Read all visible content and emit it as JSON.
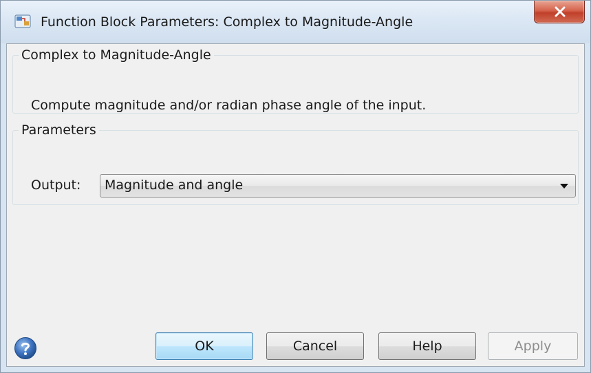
{
  "window": {
    "title": "Function Block Parameters: Complex to Magnitude-Angle",
    "close_glyph": "X"
  },
  "description_group": {
    "legend": "Complex to Magnitude-Angle",
    "text": "Compute magnitude and/or radian phase angle of the input."
  },
  "parameters_group": {
    "legend": "Parameters",
    "output_label": "Output:",
    "output_value": "Magnitude and angle"
  },
  "buttons": {
    "ok": "OK",
    "cancel": "Cancel",
    "help": "Help",
    "apply": "Apply"
  },
  "icons": {
    "app": "simulink-block-icon",
    "help": "help-question-icon",
    "close": "close-icon",
    "dropdown": "chevron-down-icon"
  },
  "colors": {
    "close_button": "#c7432c",
    "default_button_border": "#3c7fb1",
    "help_icon": "#3b6fb6"
  }
}
